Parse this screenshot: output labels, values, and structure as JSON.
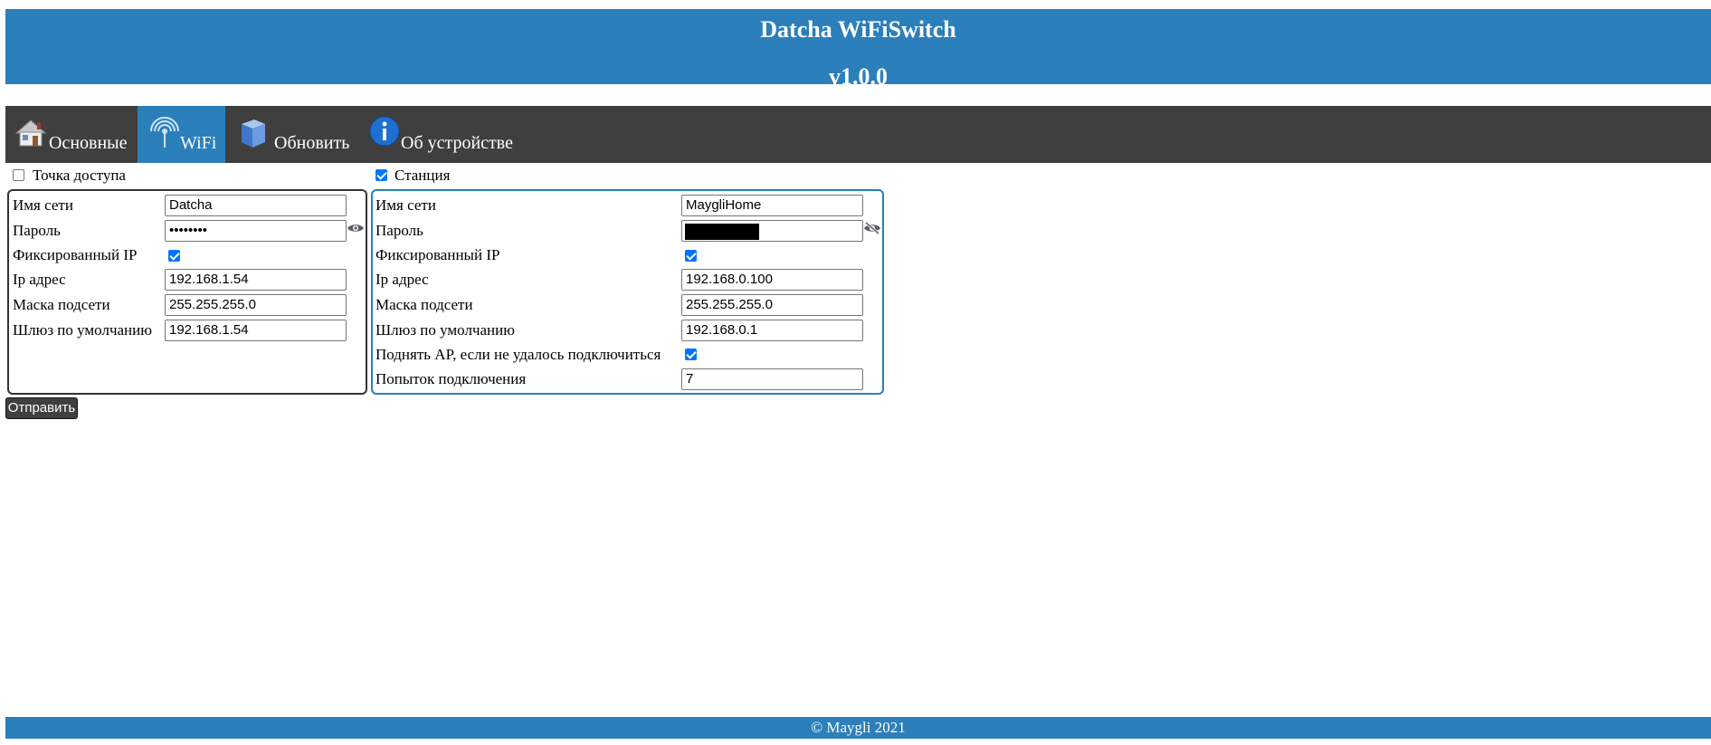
{
  "header": {
    "title": "Datcha WiFiSwitch",
    "version": "v1.0.0"
  },
  "nav": {
    "tabs": [
      {
        "label": "Основные",
        "icon": "house-icon",
        "active": false
      },
      {
        "label": "WiFi",
        "icon": "antenna-icon",
        "active": true
      },
      {
        "label": "Обновить",
        "icon": "update-box-icon",
        "active": false
      },
      {
        "label": "Об устройстве",
        "icon": "info-icon",
        "active": false
      }
    ]
  },
  "ap": {
    "toggle_label": "Точка доступа",
    "enabled": false,
    "labels": {
      "ssid": "Имя сети",
      "password": "Пароль",
      "static_ip": "Фиксированный IP",
      "ip": "Ip адрес",
      "mask": "Маска подсети",
      "gateway": "Шлюз по умолчанию"
    },
    "values": {
      "ssid": "Datcha",
      "password": "••••••••",
      "static_ip": true,
      "ip": "192.168.1.54",
      "mask": "255.255.255.0",
      "gateway": "192.168.1.54"
    }
  },
  "station": {
    "toggle_label": "Станция",
    "enabled": true,
    "labels": {
      "ssid": "Имя сети",
      "password": "Пароль",
      "static_ip": "Фиксированный IP",
      "ip": "Ip адрес",
      "mask": "Маска подсети",
      "gateway": "Шлюз по умолчанию",
      "fallback_ap": "Поднять AP, если не удалось подключиться",
      "attempts": "Попыток подключения"
    },
    "values": {
      "ssid": "MaygliHome",
      "password_redacted": true,
      "static_ip": true,
      "ip": "192.168.0.100",
      "mask": "255.255.255.0",
      "gateway": "192.168.0.1",
      "fallback_ap": true,
      "attempts": "7"
    }
  },
  "submit_label": "Отправить",
  "footer": {
    "text": "© Maygli 2021"
  },
  "colors": {
    "accent": "#2b7fbb",
    "nav_bg": "#3f3f3f",
    "checkbox": "#0075ff"
  }
}
